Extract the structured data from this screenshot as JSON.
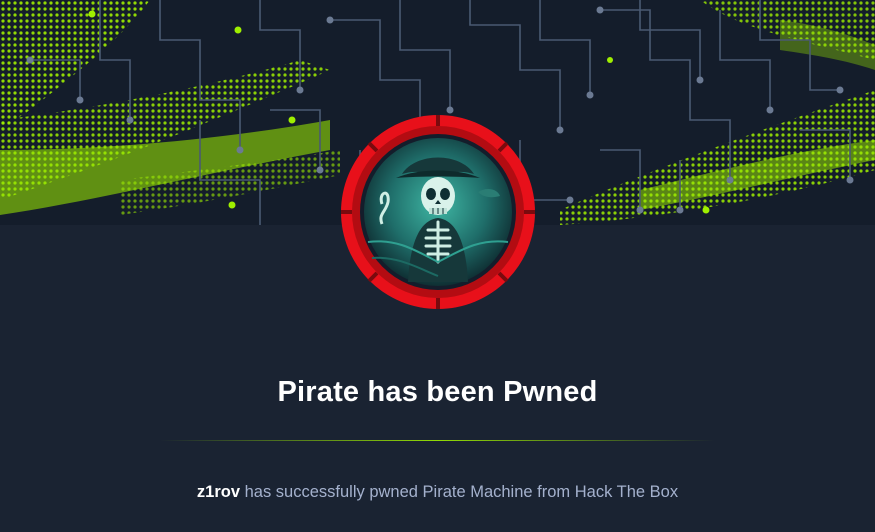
{
  "banner": {
    "accent_color": "#9fef00",
    "background_color": "#141d2b"
  },
  "machine": {
    "name": "Pirate",
    "avatar_icon": "pirate-skeleton-avatar",
    "ring_color": "#e8101a"
  },
  "heading": {
    "title": "Pirate has been Pwned"
  },
  "message": {
    "username": "z1rov",
    "text": " has successfully pwned Pirate Machine from Hack The Box"
  }
}
